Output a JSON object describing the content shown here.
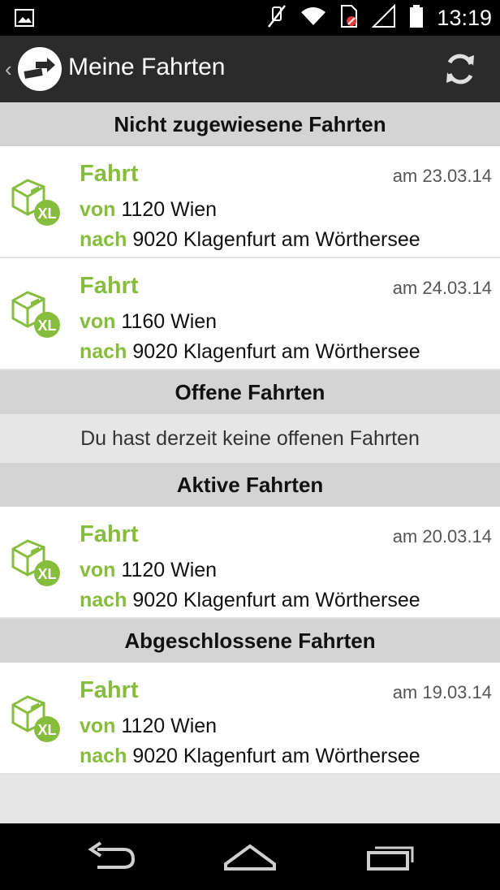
{
  "status_bar": {
    "time": "13:19",
    "icons": [
      "image-icon",
      "mute-icon",
      "wifi-icon",
      "sim-icon",
      "signal-icon",
      "battery-icon"
    ]
  },
  "action_bar": {
    "title": "Meine Fahrten",
    "icons": [
      "back-icon",
      "app-logo-icon",
      "refresh-icon"
    ]
  },
  "sections": {
    "unassigned": {
      "header": "Nicht zugewiesene Fahrten",
      "trips": [
        {
          "title": "Fahrt",
          "date": "am 23.03.14",
          "from_label": "von",
          "from": "1120 Wien",
          "to_label": "nach",
          "to": "9020 Klagenfurt am Wörthersee",
          "badge": "XL"
        },
        {
          "title": "Fahrt",
          "date": "am 24.03.14",
          "from_label": "von",
          "from": "1160 Wien",
          "to_label": "nach",
          "to": "9020 Klagenfurt am Wörthersee",
          "badge": "XL"
        }
      ]
    },
    "open": {
      "header": "Offene Fahrten",
      "empty_text": "Du hast derzeit keine offenen Fahrten"
    },
    "active": {
      "header": "Aktive Fahrten",
      "trips": [
        {
          "title": "Fahrt",
          "date": "am 20.03.14",
          "from_label": "von",
          "from": "1120 Wien",
          "to_label": "nach",
          "to": "9020 Klagenfurt am Wörthersee",
          "badge": "XL"
        }
      ]
    },
    "completed": {
      "header": "Abgeschlossene Fahrten",
      "trips": [
        {
          "title": "Fahrt",
          "date": "am 19.03.14",
          "from_label": "von",
          "from": "1120 Wien",
          "to_label": "nach",
          "to": "9020 Klagenfurt am Wörthersee",
          "badge": "XL"
        }
      ]
    }
  },
  "nav_bar": {
    "icons": [
      "back-nav-icon",
      "home-icon",
      "recent-apps-icon"
    ]
  },
  "colors": {
    "accent": "#86bd3c",
    "action_bar": "#2b2b2b",
    "section_header": "#d4d4d4",
    "background": "#e6e6e6"
  }
}
